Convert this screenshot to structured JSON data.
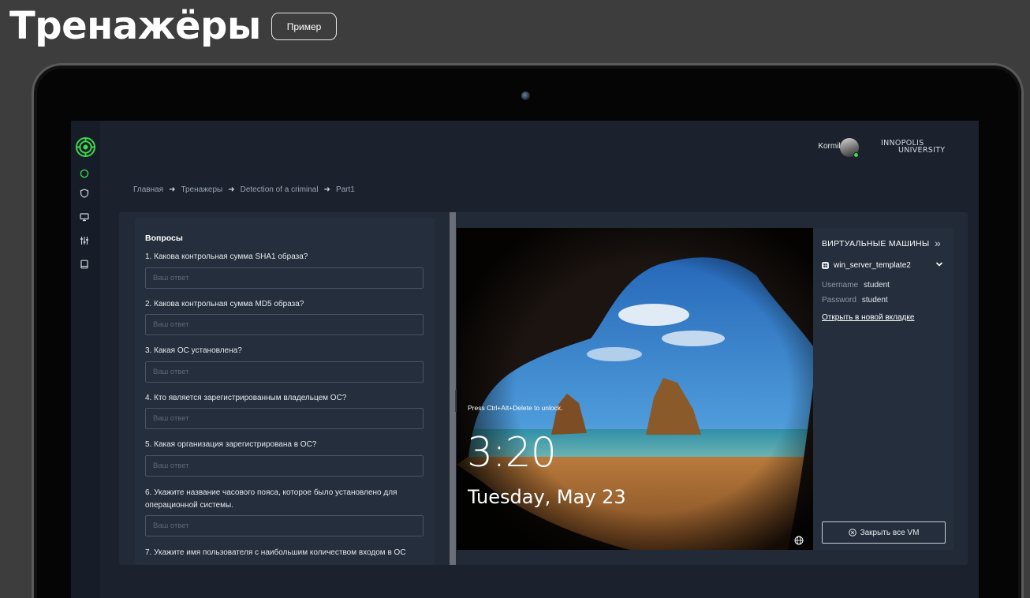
{
  "page": {
    "title": "Тренажёры",
    "example_button": "Пример"
  },
  "app": {
    "user_name": "Kormiltcev",
    "brand_line1": "INNOPOLIS",
    "brand_line2": "UNIVERSITY",
    "accent_color": "#3ddc4a"
  },
  "sidebar": {
    "items": [
      {
        "icon": "circle-icon",
        "active": true
      },
      {
        "icon": "shield-icon"
      },
      {
        "icon": "monitor-icon"
      },
      {
        "icon": "sliders-icon"
      },
      {
        "icon": "book-icon"
      }
    ]
  },
  "breadcrumb": [
    "Главная",
    "Тренажеры",
    "Detection of a criminal",
    "Part1"
  ],
  "questions": {
    "heading": "Вопросы",
    "placeholder": "Ваш ответ",
    "items": [
      "1. Какова контрольная сумма SHA1 образа?",
      "2. Какова контрольная сумма MD5 образа?",
      "3. Какая ОС установлена?",
      "4. Кто является зарегистрированным владельцем ОС?",
      "5. Какая организация зарегистрирована в ОС?",
      "6. Укажите название часового пояса, которое было установлено для операционной системы.",
      "7. Укажите имя пользователя с наибольшим количеством входом в ОС"
    ]
  },
  "vm_screen": {
    "hint": "Press Ctrl+Alt+Delete to unlock.",
    "time": "3:20",
    "date": "Tuesday, May 23"
  },
  "vm_panel": {
    "title": "ВИРТУАЛЬНЫЕ МАШИНЫ",
    "vm_name": "win_server_template2",
    "username_label": "Username",
    "username_value": "student",
    "password_label": "Password",
    "password_value": "student",
    "open_link": "Открыть в новой вкладке",
    "close_all": "Закрыть все VM"
  }
}
